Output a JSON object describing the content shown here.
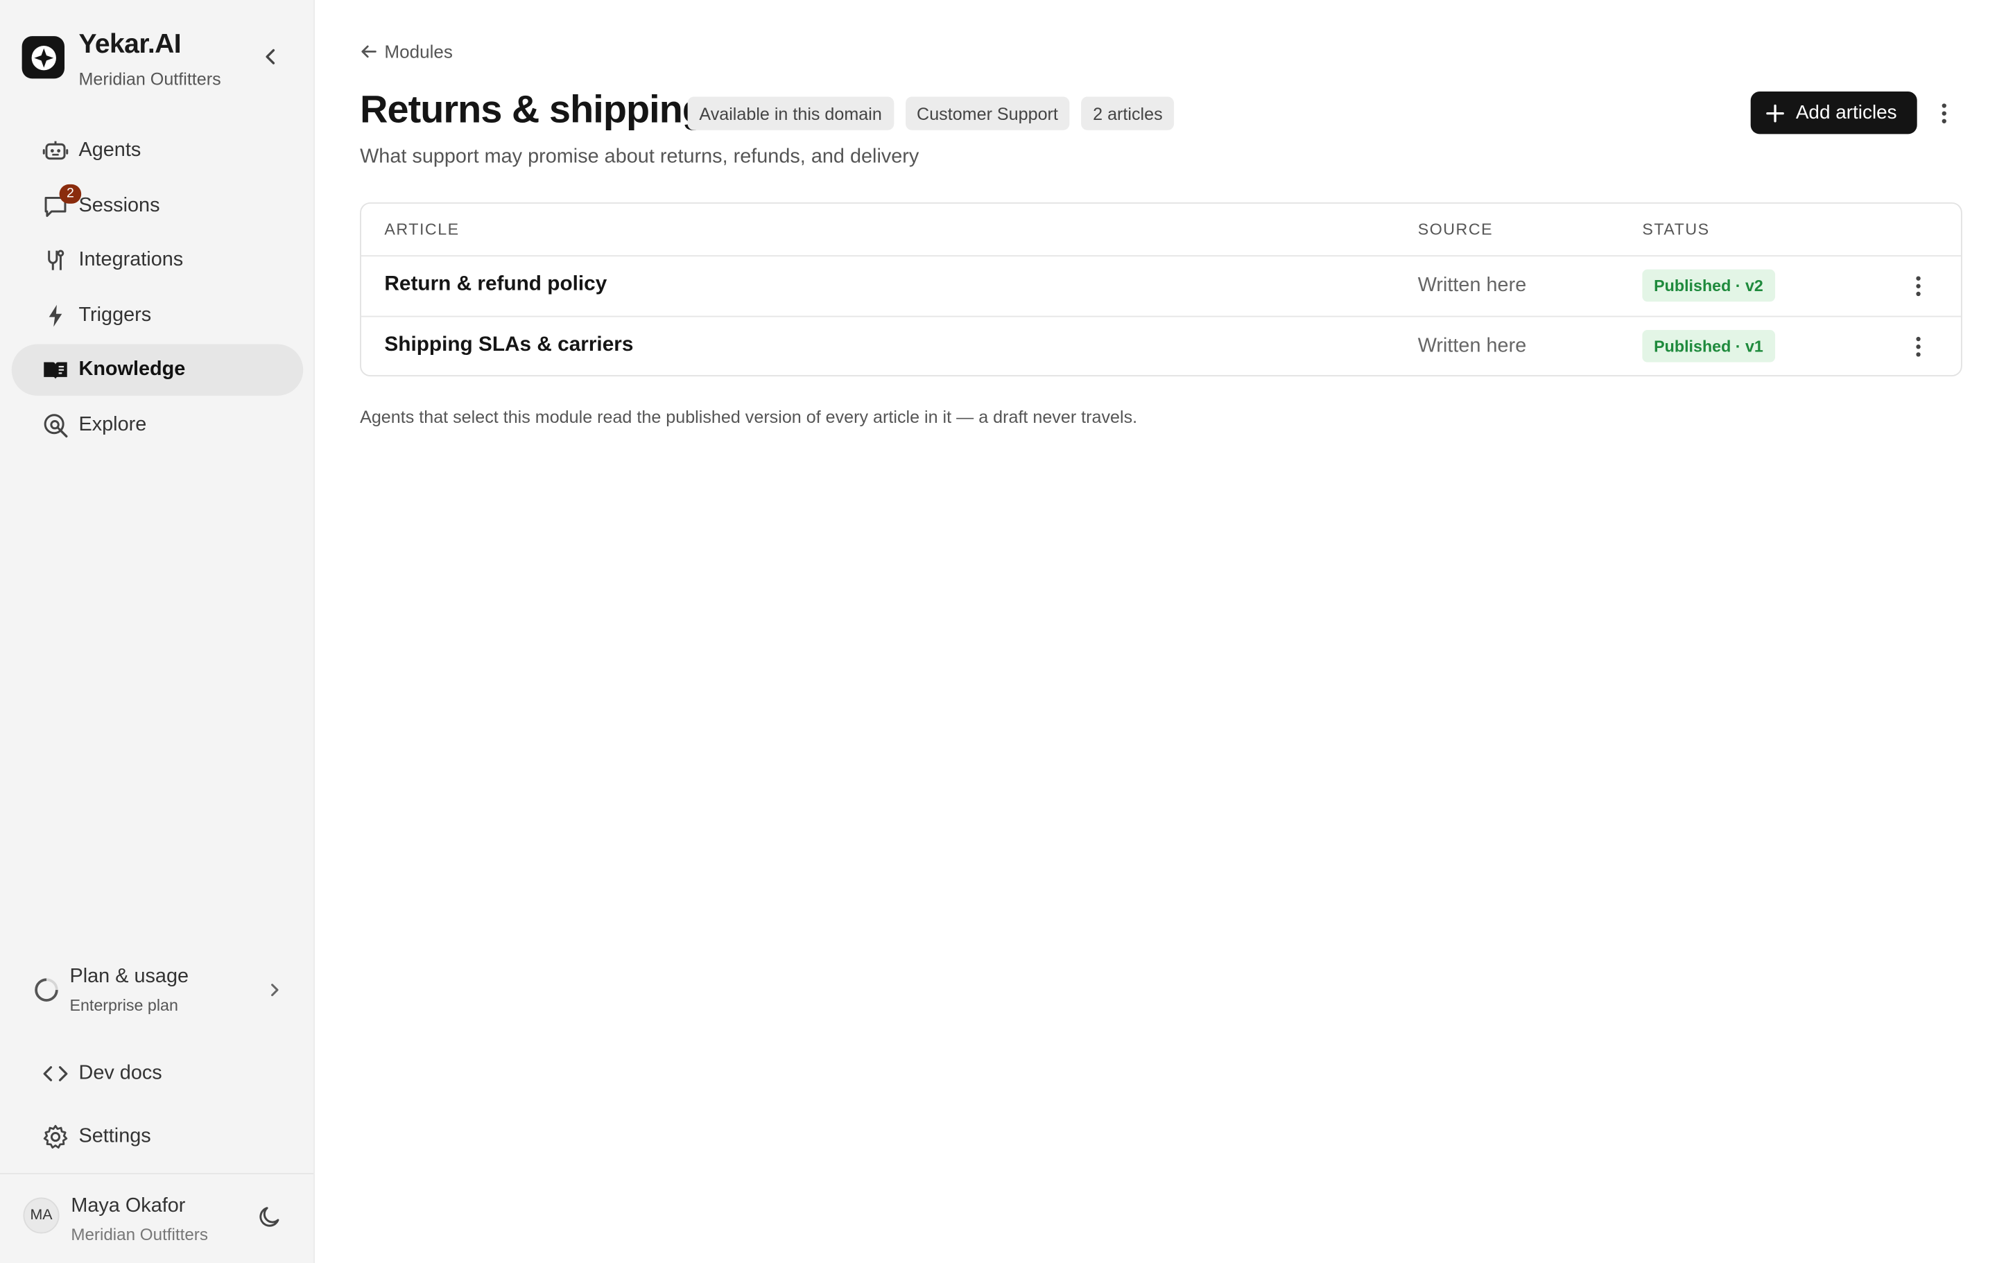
{
  "brand": {
    "name": "Yekar.AI",
    "org": "Meridian Outfitters"
  },
  "nav": [
    {
      "label": "Agents",
      "icon": "robot-icon",
      "active": false
    },
    {
      "label": "Sessions",
      "icon": "chat-icon",
      "badge": "2",
      "active": false
    },
    {
      "label": "Integrations",
      "icon": "plug-icon",
      "active": false
    },
    {
      "label": "Triggers",
      "icon": "bolt-icon",
      "active": false
    },
    {
      "label": "Knowledge",
      "icon": "book-icon",
      "active": true
    },
    {
      "label": "Explore",
      "icon": "search-globe-icon",
      "active": false
    }
  ],
  "plan": {
    "title": "Plan & usage",
    "subtitle": "Enterprise plan"
  },
  "footer_nav": [
    {
      "label": "Dev docs",
      "icon": "code-icon"
    },
    {
      "label": "Settings",
      "icon": "gear-icon"
    }
  ],
  "user": {
    "initials": "MA",
    "name": "Maya Okafor",
    "org": "Meridian Outfitters"
  },
  "breadcrumb": {
    "back_label": "Modules"
  },
  "page": {
    "title": "Returns & shipping",
    "pills": [
      "Available in this domain",
      "Customer Support",
      "2 articles"
    ],
    "subtitle": "What support may promise about returns, refunds, and delivery",
    "add_button": "Add articles"
  },
  "table": {
    "columns": [
      "ARTICLE",
      "SOURCE",
      "STATUS"
    ],
    "rows": [
      {
        "title": "Return & refund policy",
        "source": "Written here",
        "status": "Published · v2"
      },
      {
        "title": "Shipping SLAs & carriers",
        "source": "Written here",
        "status": "Published · v1"
      }
    ]
  },
  "footnote": "Agents that select this module read the published version of every article in it — a draft never travels.",
  "colors": {
    "accent_dark": "#141414",
    "badge": "#8a2c0d",
    "status_text": "#1e8a3c",
    "status_bg": "#e3f5e6"
  }
}
